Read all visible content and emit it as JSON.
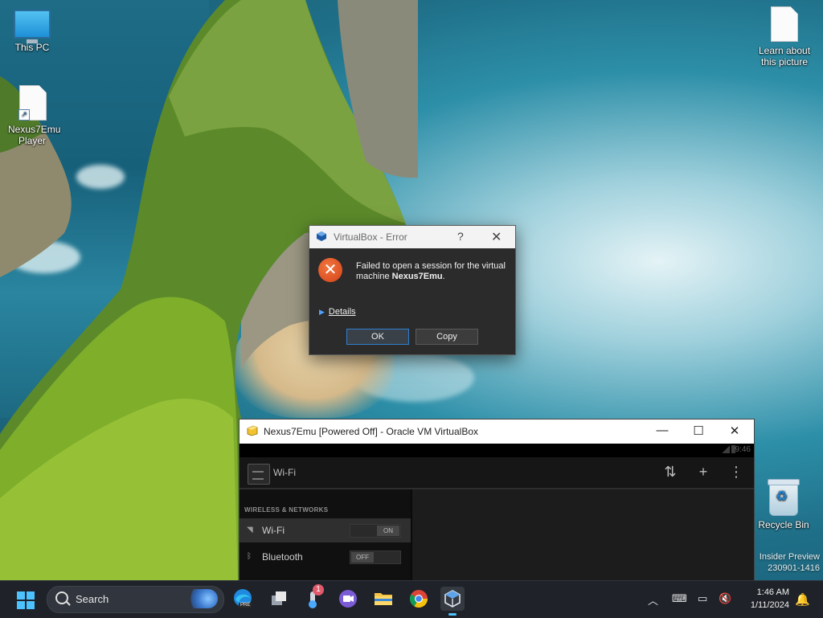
{
  "desktop": {
    "icons": [
      {
        "label": "This PC"
      },
      {
        "label": "Nexus7Emu Player"
      },
      {
        "label": "Learn about this picture"
      },
      {
        "label": "Recycle Bin"
      }
    ],
    "watermark": {
      "line1": "Insider Preview",
      "line2": "230901-1416"
    }
  },
  "error_dialog": {
    "title": "VirtualBox - Error",
    "help_glyph": "?",
    "close_glyph": "✕",
    "message_prefix": "Failed to open a session for the virtual machine",
    "vm_name": "Nexus7Emu",
    "message_suffix": ".",
    "details_label": "Details",
    "ok_label": "OK",
    "copy_label": "Copy",
    "icon": "error-icon"
  },
  "vm_window": {
    "title": "Nexus7Emu [Powered Off] - Oracle VM VirtualBox",
    "minimize_glyph": "—",
    "maximize_glyph": "☐",
    "close_glyph": "✕",
    "android": {
      "status_time": "9:46",
      "screen_title": "Wi-Fi",
      "section_header": "WIRELESS & NETWORKS",
      "rows": [
        {
          "label": "Wi-Fi",
          "toggle": "ON",
          "selected": true
        },
        {
          "label": "Bluetooth",
          "toggle": "OFF",
          "selected": false
        }
      ]
    }
  },
  "taskbar": {
    "search_label": "Search",
    "notification_badge": "1",
    "edge_badge": "PRE",
    "clock_time": "1:46 AM",
    "clock_date": "1/11/2024"
  },
  "colors": {
    "accent": "#4cc2ff",
    "error": "#e2531f",
    "taskbar_bg": "#1f2329"
  }
}
